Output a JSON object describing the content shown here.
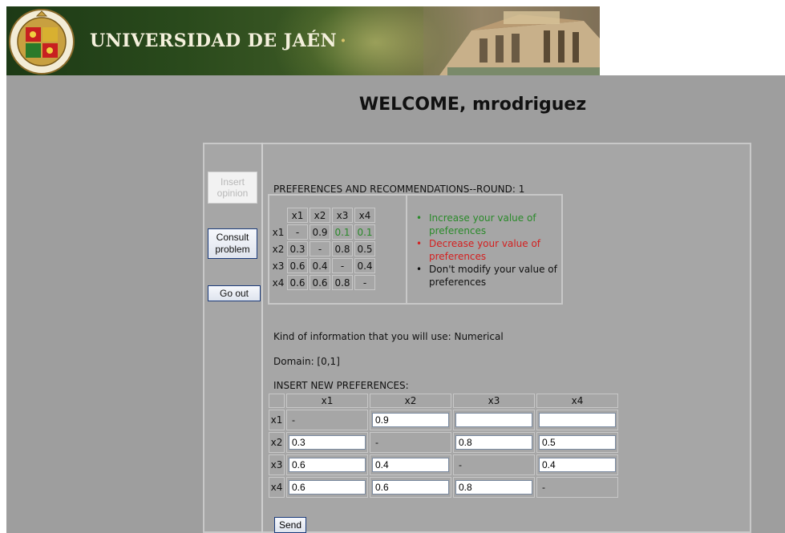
{
  "header": {
    "university_name": "UNIVERSIDAD DE JAÉN",
    "separator": "·"
  },
  "welcome": "WELCOME, mrodriguez",
  "nav": {
    "insert_opinion": "Insert opinion",
    "consult_problem": "Consult problem",
    "go_out": "Go out"
  },
  "preferences": {
    "title": "PREFERENCES AND RECOMMENDATIONS--ROUND: 1",
    "columns": [
      "x1",
      "x2",
      "x3",
      "x4"
    ],
    "rows": [
      {
        "label": "x1",
        "values": [
          "-",
          "0.9",
          "0.1",
          "0.1"
        ],
        "colors": [
          "black",
          "black",
          "green",
          "green"
        ]
      },
      {
        "label": "x2",
        "values": [
          "0.3",
          "-",
          "0.8",
          "0.5"
        ],
        "colors": [
          "black",
          "black",
          "black",
          "black"
        ]
      },
      {
        "label": "x3",
        "values": [
          "0.6",
          "0.4",
          "-",
          "0.4"
        ],
        "colors": [
          "black",
          "black",
          "black",
          "black"
        ]
      },
      {
        "label": "x4",
        "values": [
          "0.6",
          "0.6",
          "0.8",
          "-"
        ],
        "colors": [
          "black",
          "black",
          "black",
          "black"
        ]
      }
    ]
  },
  "legend": {
    "increase": "Increase your value of preferences",
    "decrease": "Decrease your value of preferences",
    "keep": "Don't modify your value of preferences",
    "bullet": "•",
    "colors": {
      "increase": "#2a8a2a",
      "decrease": "#d42020",
      "keep": "#111111"
    }
  },
  "info": {
    "kind": "Kind of information that you will use: Numerical",
    "domain": "Domain: [0,1]",
    "insert_title": "INSERT NEW PREFERENCES:"
  },
  "new_prefs": {
    "columns": [
      "x1",
      "x2",
      "x3",
      "x4"
    ],
    "rows": [
      {
        "label": "x1",
        "cells": [
          {
            "type": "text",
            "value": "-"
          },
          {
            "type": "input",
            "value": "0.9"
          },
          {
            "type": "input",
            "value": ""
          },
          {
            "type": "input",
            "value": ""
          }
        ]
      },
      {
        "label": "x2",
        "cells": [
          {
            "type": "input",
            "value": "0.3"
          },
          {
            "type": "text",
            "value": "-"
          },
          {
            "type": "input",
            "value": "0.8"
          },
          {
            "type": "input",
            "value": "0.5"
          }
        ]
      },
      {
        "label": "x3",
        "cells": [
          {
            "type": "input",
            "value": "0.6"
          },
          {
            "type": "input",
            "value": "0.4"
          },
          {
            "type": "text",
            "value": "-"
          },
          {
            "type": "input",
            "value": "0.4"
          }
        ]
      },
      {
        "label": "x4",
        "cells": [
          {
            "type": "input",
            "value": "0.6"
          },
          {
            "type": "input",
            "value": "0.6"
          },
          {
            "type": "input",
            "value": "0.8"
          },
          {
            "type": "text",
            "value": "-"
          }
        ]
      }
    ]
  },
  "send_label": "Send",
  "colors": {
    "gray_bg": "#9e9e9e",
    "panel_bg": "#a6a6a6",
    "banner_dark": "#1d3a16"
  }
}
